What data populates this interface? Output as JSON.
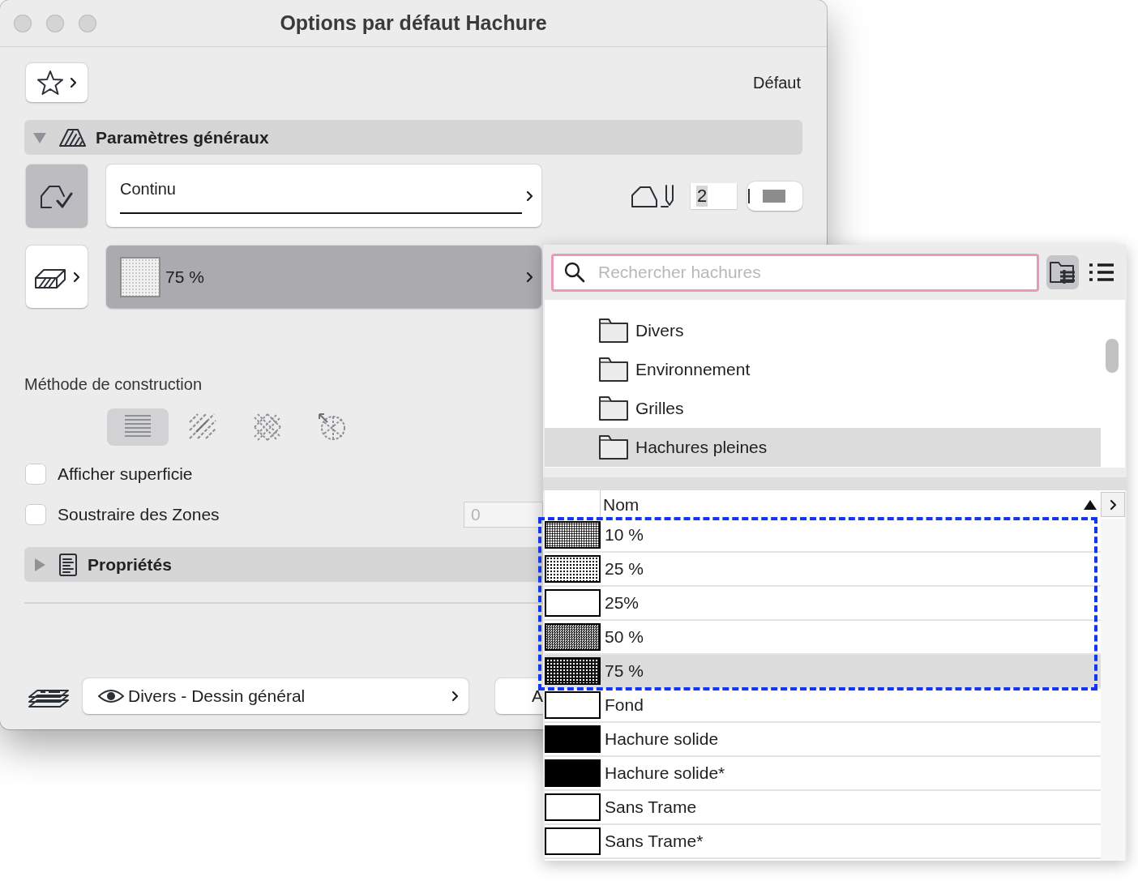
{
  "window": {
    "title": "Options par défaut Hachure"
  },
  "preset_label": "Défaut",
  "general_section": {
    "title": "Paramètres généraux",
    "expanded": true
  },
  "contour_toggle": {
    "on": true
  },
  "line_type": {
    "name": "Continu"
  },
  "pen": {
    "value": "2"
  },
  "fill_type": {
    "name": "75 %",
    "kind": "dense-dots"
  },
  "construction": {
    "label": "Méthode de construction",
    "methods": [
      {
        "kind": "parallel",
        "selected": true
      },
      {
        "kind": "linear",
        "selected": false
      },
      {
        "kind": "grid",
        "selected": false
      },
      {
        "kind": "radial",
        "selected": false
      }
    ]
  },
  "checkboxes": [
    {
      "label": "Afficher superficie",
      "checked": false
    },
    {
      "label": "Soustraire des Zones",
      "checked": false
    }
  ],
  "area_field": {
    "value": "0",
    "disabled": true
  },
  "properties_section": {
    "title": "Propriétés",
    "expanded": false
  },
  "layer": {
    "label": "Divers - Dessin général",
    "visible": true
  },
  "partial_button": {
    "label": "A"
  },
  "picker": {
    "search": {
      "placeholder": "Rechercher hachures"
    },
    "view_modes": [
      {
        "kind": "folders",
        "selected": true
      },
      {
        "kind": "list",
        "selected": false
      }
    ],
    "folders": [
      {
        "name": "Divers",
        "selected": false
      },
      {
        "name": "Environnement",
        "selected": false
      },
      {
        "name": "Grilles",
        "selected": false
      },
      {
        "name": "Hachures pleines",
        "selected": true
      }
    ],
    "table": {
      "columns": [
        {
          "label": "Nom",
          "sorted": true
        }
      ],
      "rows": [
        {
          "name": "10 %",
          "kind": "fine-dots",
          "selected": false,
          "outlined": true
        },
        {
          "name": "25 %",
          "kind": "dots",
          "selected": false,
          "outlined": true
        },
        {
          "name": "25%",
          "kind": "empty",
          "selected": false,
          "outlined": true
        },
        {
          "name": "50 %",
          "kind": "grey-dots",
          "selected": false,
          "outlined": true
        },
        {
          "name": "75 %",
          "kind": "dense-dots",
          "selected": true,
          "outlined": true
        },
        {
          "name": "Fond",
          "kind": "empty",
          "selected": false,
          "outlined": false
        },
        {
          "name": "Hachure solide",
          "kind": "solid",
          "selected": false,
          "outlined": false
        },
        {
          "name": "Hachure solide*",
          "kind": "solid",
          "selected": false,
          "outlined": false
        },
        {
          "name": "Sans Trame",
          "kind": "empty",
          "selected": false,
          "outlined": false
        },
        {
          "name": "Sans Trame*",
          "kind": "empty",
          "selected": false,
          "outlined": false
        }
      ]
    }
  }
}
